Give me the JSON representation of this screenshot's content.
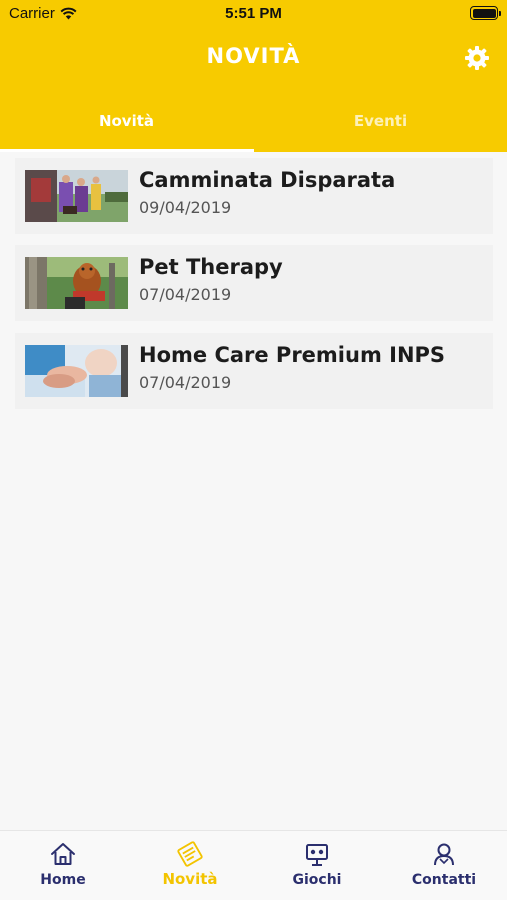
{
  "status_bar": {
    "carrier": "Carrier",
    "time": "5:51 PM"
  },
  "header": {
    "title": "NOVITÀ"
  },
  "tabs": [
    {
      "label": "Novità",
      "active": true
    },
    {
      "label": "Eventi",
      "active": false
    }
  ],
  "news": [
    {
      "title": "Camminata Disparata",
      "date": "09/04/2019"
    },
    {
      "title": "Pet Therapy",
      "date": "07/04/2019"
    },
    {
      "title": "Home Care Premium INPS",
      "date": "07/04/2019"
    }
  ],
  "tabbar": [
    {
      "label": "Home",
      "icon": "house-icon",
      "active": false
    },
    {
      "label": "Novità",
      "icon": "newspaper-icon",
      "active": true
    },
    {
      "label": "Giochi",
      "icon": "game-box-icon",
      "active": false
    },
    {
      "label": "Contatti",
      "icon": "person-icon",
      "active": false
    }
  ],
  "colors": {
    "brand": "#f7cb00",
    "tab_label": "#2b2f6e",
    "tab_active": "#f3c400"
  }
}
